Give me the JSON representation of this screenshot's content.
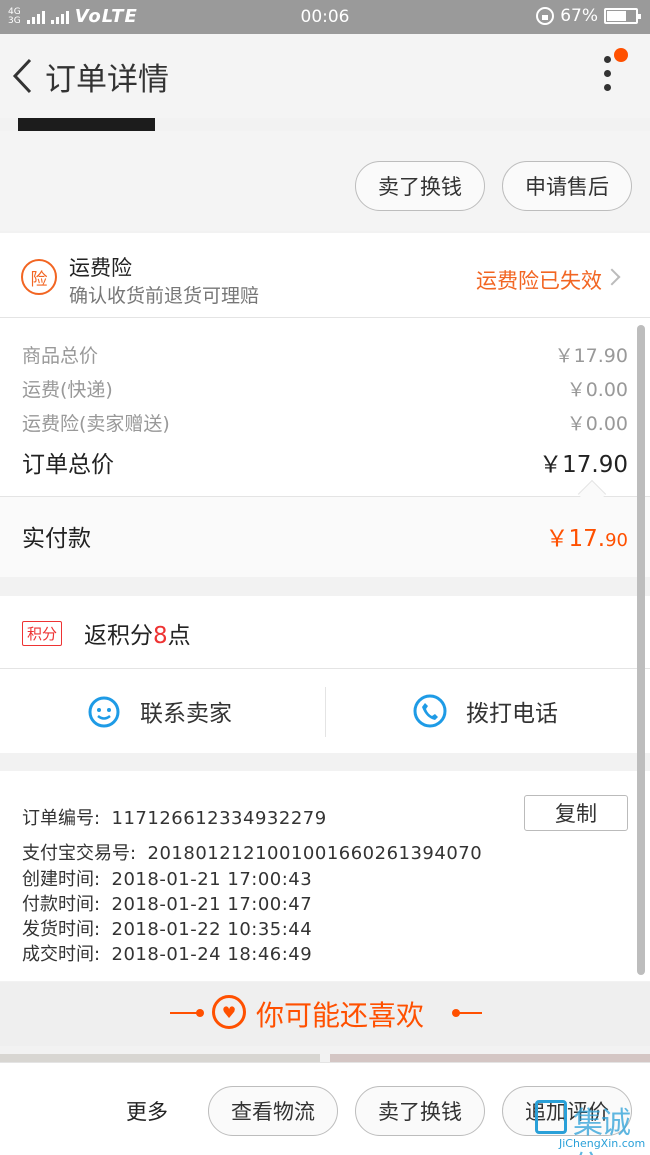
{
  "status_bar": {
    "net_top": "4G",
    "net_bottom": "3G",
    "volte": "VoLTE",
    "time": "00:06",
    "battery_text": "67%",
    "battery_level": 0.67
  },
  "header": {
    "title": "订单详情"
  },
  "actions": {
    "sell_label": "卖了换钱",
    "after_sale_label": "申请售后"
  },
  "insurance": {
    "badge": "险",
    "name": "运费险",
    "desc": "确认收货前退货可理赔",
    "status": "运费险已失效"
  },
  "price": {
    "rows": [
      {
        "label": "商品总价",
        "value": "￥17.90"
      },
      {
        "label": "运费(快递)",
        "value": "￥0.00"
      },
      {
        "label": "运费险(卖家赠送)",
        "value": "￥0.00"
      }
    ],
    "total_label": "订单总价",
    "total_value": "￥17.90",
    "paid_label": "实付款",
    "paid_main": "￥17.",
    "paid_cents": "90"
  },
  "points": {
    "tag": "积分",
    "prefix": "返积分",
    "count": "8",
    "suffix": "点"
  },
  "contact": {
    "seller_label": "联系卖家",
    "phone_label": "拨打电话"
  },
  "order_info": {
    "copy_label": "复制",
    "rows": [
      {
        "label": "订单编号:",
        "value": "117126612334932279"
      },
      {
        "label": "支付宝交易号:",
        "value": "2018012121001001660261394070"
      },
      {
        "label": "创建时间:",
        "value": "2018-01-21 17:00:43"
      },
      {
        "label": "付款时间:",
        "value": "2018-01-21 17:00:47"
      },
      {
        "label": "发货时间:",
        "value": "2018-01-22 10:35:44"
      },
      {
        "label": "成交时间:",
        "value": "2018-01-24 18:46:49"
      }
    ]
  },
  "guess": {
    "title": "你可能还喜欢"
  },
  "bottom": {
    "more_label": "更多",
    "logistics_label": "查看物流",
    "sell_label": "卖了换钱",
    "review_label": "追加评价"
  },
  "watermark": {
    "cn": "集诚信",
    "en": "JiChengXin.com"
  },
  "colors": {
    "accent": "#ff5000",
    "insurance": "#f26522",
    "link_blue": "#1e9be6"
  }
}
